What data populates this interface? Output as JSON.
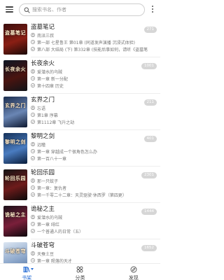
{
  "header": {
    "search_placeholder": "搜索书名、作者"
  },
  "books": [
    {
      "title": "盗墓笔记",
      "author": "南派三叔",
      "latest": "第一部 七星鲁王 第01章 (同道发声演播 沉浸式体验)",
      "read": "第八部 大结局 (下) 第332章 (技能后事如何，请听《盗墓笔",
      "unread": "271",
      "cover_text": "盗墓笔记",
      "cover_colors": [
        "#3a0d0d",
        "#8a1f14",
        "#1a0a08"
      ]
    },
    {
      "title": "长夜余火",
      "author": "爱潜水的乌贼",
      "latest": "第一章 新一分配",
      "read": "第十四章 历史",
      "unread": "1001",
      "cover_text": "长夜余火",
      "cover_colors": [
        "#0d1624",
        "#4a1410",
        "#101418"
      ]
    },
    {
      "title": "玄界之门",
      "author": "忘语",
      "latest": "第1章 序幕",
      "read": "第1112章 飞升之劫",
      "unread": "211",
      "cover_text": "玄界之门",
      "cover_colors": [
        "#1c2d4e",
        "#6a86b4",
        "#0e1830"
      ]
    },
    {
      "title": "黎明之剑",
      "author": "远瞳",
      "latest": "第一章 穿越成一个很角色怎么办",
      "read": "第一百八十一章",
      "unread": "401",
      "cover_text": "黎明之剑",
      "cover_colors": [
        "#15325a",
        "#4a7cc0",
        "#0a1d3a"
      ]
    },
    {
      "title": "轮回乐园",
      "author": "那一只蚊子",
      "latest": "第一章：复仇者",
      "read": "第一千零二十二章：天灵驱驶·休西罗（第四更）",
      "unread": "2301",
      "cover_text": "轮回乐园",
      "cover_colors": [
        "#141414",
        "#6e1b1b",
        "#0a0a0a"
      ]
    },
    {
      "title": "诡秘之主",
      "author": "爱潜水的乌贼",
      "latest": "第一章 绯红",
      "read": "一个普通人的日常（五）",
      "unread": "1444",
      "cover_text": "诡秘之主",
      "cover_colors": [
        "#1a1018",
        "#7a1f3a",
        "#0d080c"
      ]
    },
    {
      "title": "斗破苍穹",
      "author": "天蚕土豆",
      "latest": "第一章 陨落的天才",
      "read": "第一千六百二十三章",
      "unread": "1652",
      "cover_text": "斗破苍穹",
      "cover_colors": [
        "#dce6f2",
        "#8fa9cc",
        "#4d6d9a"
      ]
    }
  ],
  "bottom_nav": [
    {
      "label": "书架",
      "icon": "bookshelf-icon",
      "active": true
    },
    {
      "label": "分类",
      "icon": "category-grid-icon",
      "active": false
    },
    {
      "label": "发现",
      "icon": "compass-icon",
      "active": false
    }
  ],
  "colors": {
    "accent": "#2a6fd6",
    "badge": "#d6d6d6",
    "text_secondary": "#777777"
  }
}
